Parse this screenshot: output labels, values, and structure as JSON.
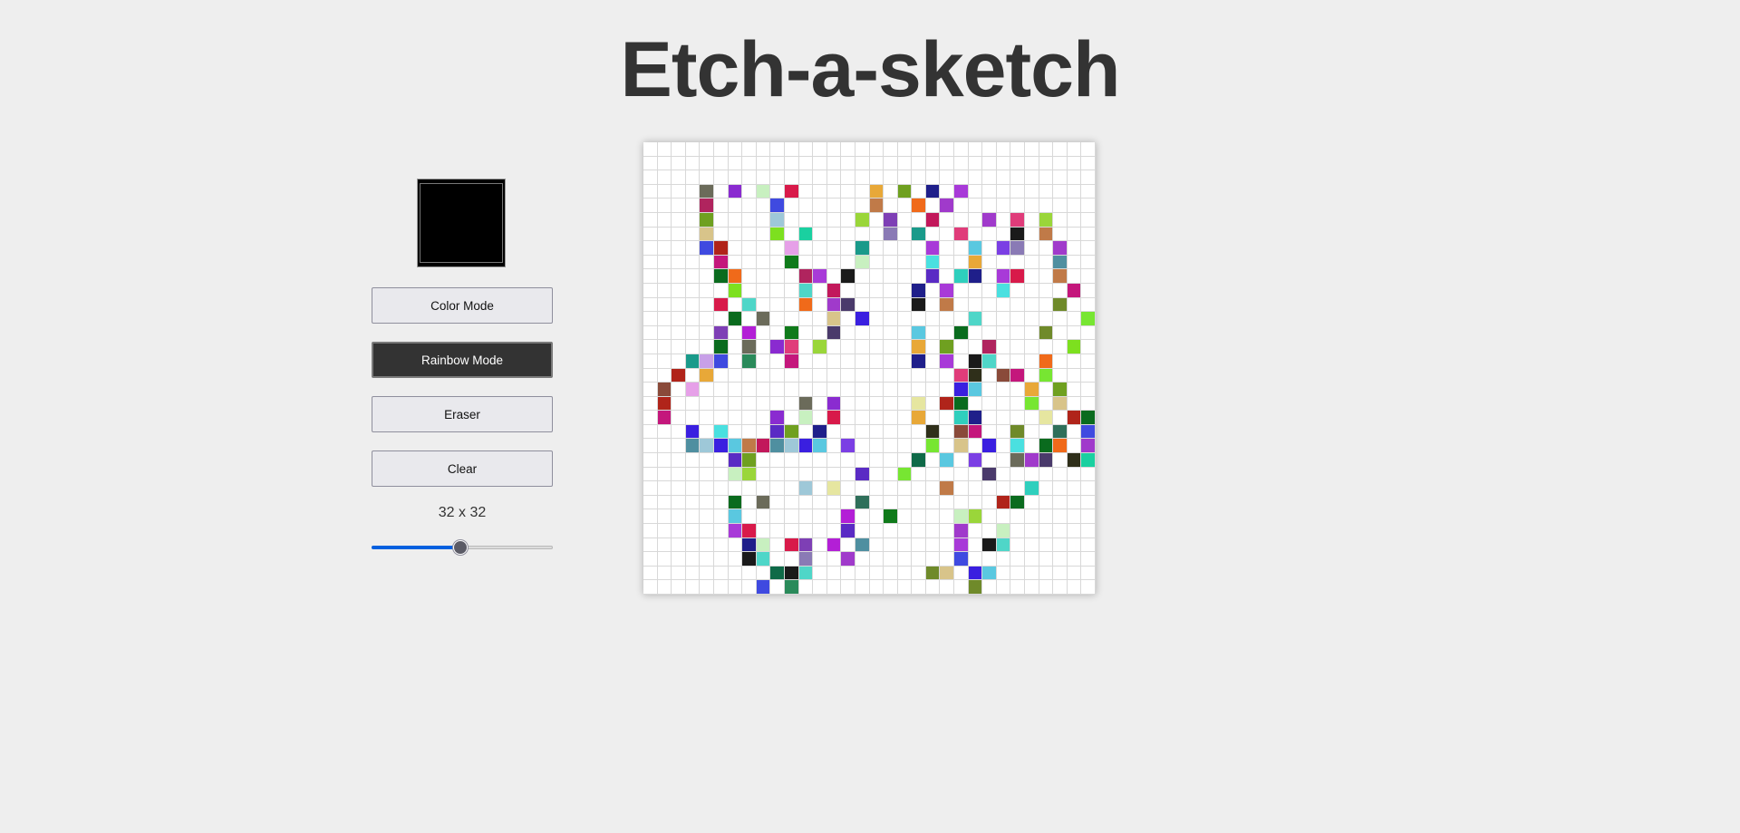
{
  "app": {
    "title": "Etch-a-sketch"
  },
  "controls": {
    "current_color": "#000000",
    "buttons": [
      {
        "id": "color-mode",
        "label": "Color Mode",
        "active": false
      },
      {
        "id": "rainbow-mode",
        "label": "Rainbow Mode",
        "active": true
      },
      {
        "id": "eraser",
        "label": "Eraser",
        "active": false
      },
      {
        "id": "clear",
        "label": "Clear",
        "active": false
      }
    ],
    "grid_size_label": "32 x 32",
    "grid_size": {
      "value": 32,
      "min": 1,
      "max": 64
    }
  },
  "board": {
    "grid_size": 32,
    "background": "#ffffff",
    "line_color": "#d8d8d8",
    "rows": [
      "................................",
      "................................",
      "................................",
      "....#.#.#.#.....#.#.#.#.........",
      "....#....#......#..#.#..........",
      "....#....#.....#.#..#...#.#.#...",
      "....#....#.#.....#.#..#...#.#...",
      "....##....#....#....#..#.##..#..",
      ".....#....#....#....#..#.....#..",
      ".....##....##.#.....#.##.##..#..",
      "......#....#.#.....#.#...#....#.",
      ".....#.#...#.##....#.#.......#..",
      "......#.#....#.#.......#.......#",
      ".....#.#..#..#.....#..#.....#...",
      ".....#.#.##.#......#.#..#.....#.",
      "...###.#..#........#.#.##...#...",
      "..#.#.................##.##.#...",
      ".#.#..................##...#.#..",
      ".#.........#.#.....#.##....#.#..",
      ".#.......#.#.#.....#..##....#.##",
      "...#.#...##.#.......#.##..#..#.#",
      "...##########.#.....#.#.#.#.##.#",
      "......##...........#.#.#..###.##",
      "......##.......#..#.....#.......",
      "...........#.#.......#.....#....",
      "......#.#......#.........##.....",
      "......#.......#..#....##........",
      "......##......#.......#..#......",
      ".......##.##.#.#......#.##......",
      ".......##..#..#.......#.........",
      ".........###........##.##.......",
      "........#.#............#........"
    ],
    "palette": [
      "#7e3fb5",
      "#4fd6c8",
      "#c07a48",
      "#7b3fe4",
      "#0a6b1e",
      "#e8a838",
      "#5a2bc4",
      "#c4177c",
      "#e6a0e8",
      "#b31fd6",
      "#c2185b",
      "#8a7ab5",
      "#f06a1a",
      "#6b6b5a",
      "#6fa020",
      "#2fcfbd",
      "#77e632",
      "#6f8a2a",
      "#4f8fa0",
      "#0f7a1a",
      "#1a9a8a",
      "#a03acb",
      "#8a2bd0",
      "#1f1f8a",
      "#b0245e",
      "#d8c48a",
      "#9ec8d8",
      "#2f6f5a",
      "#c8a0e8",
      "#4a3a6b",
      "#e03c7a",
      "#c8f0c0",
      "#a83ad8",
      "#0f6a48",
      "#3a1fe0",
      "#e6e6a0",
      "#3f4ae0",
      "#7de01f",
      "#2f2f1a",
      "#9ad63a",
      "#d81a4a",
      "#1a1a1a",
      "#5ac8e0",
      "#4ae0e0",
      "#b0241a",
      "#2a8a5a",
      "#1ad0a0",
      "#8a4a3a"
    ]
  }
}
